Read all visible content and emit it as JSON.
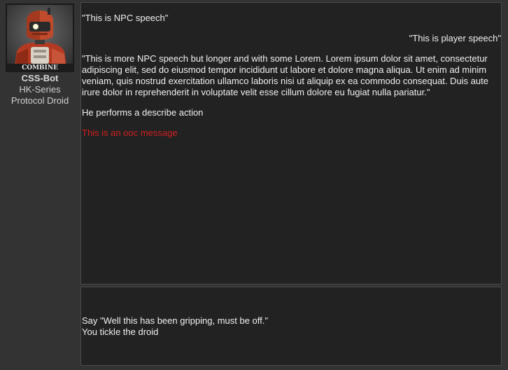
{
  "profile": {
    "portrait_icon": "robot-portrait",
    "portrait_badge": "COMBINE",
    "name": "CSS-Bot",
    "series": "HK-Series",
    "role": "Protocol Droid"
  },
  "log": {
    "npc_speech": "\"This is NPC speech\"",
    "player_speech": "\"This is player speech\"",
    "npc_speech_long": "\"This is more NPC speech but longer and with some Lorem. Lorem ipsum dolor sit amet, consectetur adipiscing elit, sed do eiusmod tempor incididunt ut labore et dolore magna aliqua. Ut enim ad minim veniam, quis nostrud exercitation ullamco laboris nisi ut aliquip ex ea commodo consequat. Duis aute irure dolor in reprehenderit in voluptate velit esse cillum dolore eu fugiat nulla pariatur.\"",
    "action": "He performs a describe action",
    "ooc": "This is an ooc message"
  },
  "commands": {
    "say": "Say \"Well this has been gripping, must be off.\"",
    "tickle": "You tickle the droid"
  },
  "colors": {
    "background": "#333333",
    "panel": "#222222",
    "text": "#f0f0f0",
    "ooc": "#d11f1f"
  }
}
